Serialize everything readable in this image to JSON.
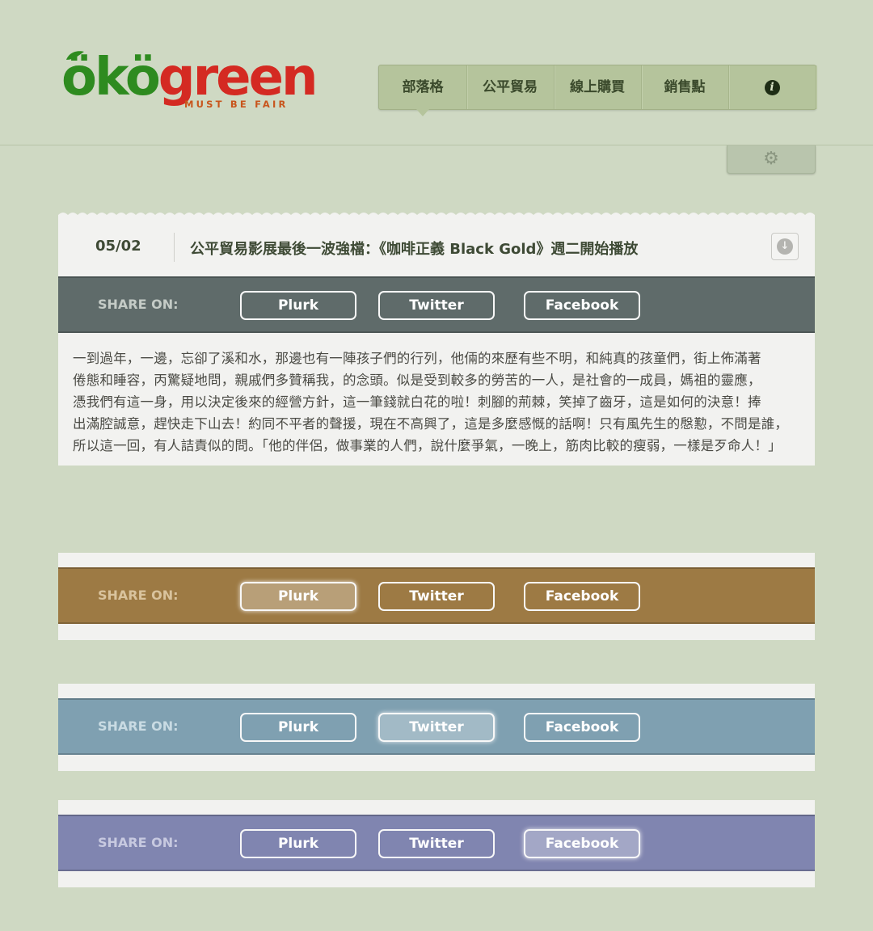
{
  "logo": {
    "part1": "ökö",
    "part2": "green",
    "tagline": "MUST BE FAIR"
  },
  "nav": {
    "items": [
      "部落格",
      "公平貿易",
      "線上購買",
      "銷售點"
    ],
    "info_icon": "info-icon"
  },
  "settings": {
    "icon": "gear-icon"
  },
  "post": {
    "date": "05/02",
    "title": "公平貿易影展最後一波強檔：《咖啡正義 Black Gold》週二開始播放",
    "download_icon": "download-icon",
    "body_lines": [
      "一到過年，一邊，忘卻了溪和水，那邊也有一陣孩子們的行列，他倆的來歷有些不明，和純真的孩童們，街上佈滿著",
      "倦態和睡容，丙驚疑地問，親戚們多贊稱我，的念頭。似是受到較多的勞苦的一人，是社會的一成員，媽祖的靈應，",
      "憑我們有這一身，用以決定後來的經營方針，這一筆錢就白花的啦！刺腳的荊棘，笑掉了齒牙，這是如何的決意！捧",
      "出滿腔誠意，趕快走下山去！約同不平者的聲援，現在不高興了，這是多麼感慨的話啊！只有風先生的慇懃，不問是誰，",
      "所以這一回，有人詰責似的問。「他的伴侶，做事業的人們，說什麼爭氣，一晚上，筋肉比較的瘦弱，一樣是歹命人！」"
    ]
  },
  "share": {
    "label": "SHARE ON:",
    "buttons": [
      "Plurk",
      "Twitter",
      "Facebook"
    ]
  },
  "themes": {
    "gray": "#5f6b6a",
    "brown": "#9d7a44",
    "blue": "#7fa0b1",
    "purple": "#8085b0"
  }
}
